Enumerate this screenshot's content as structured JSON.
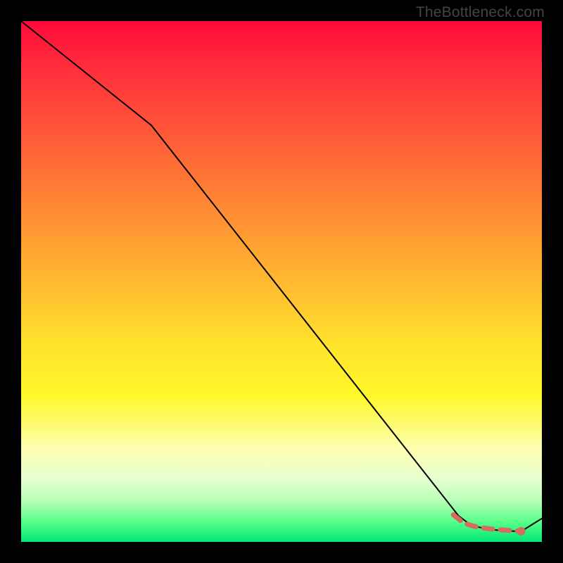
{
  "brand": "TheBottleneck.com",
  "colors": {
    "line": "#000000",
    "dashed": "#d86a60",
    "marker": "#d86a60",
    "background_black": "#000000"
  },
  "chart_data": {
    "type": "line",
    "title": "",
    "xlabel": "",
    "ylabel": "",
    "xlim": [
      0,
      100
    ],
    "ylim": [
      0,
      100
    ],
    "grid": false,
    "series": [
      {
        "name": "black-curve",
        "style": "solid",
        "color": "#000000",
        "x": [
          0,
          25,
          84,
          86,
          88,
          90,
          92,
          94,
          96,
          100
        ],
        "y": [
          100,
          80,
          5,
          3.5,
          2.8,
          2.4,
          2.2,
          2.1,
          2.0,
          4.5
        ]
      },
      {
        "name": "secondary-dashed",
        "style": "dashed",
        "color": "#d86a60",
        "x": [
          83,
          85,
          87,
          88.5,
          90,
          91.5,
          93,
          94.5,
          96
        ],
        "y": [
          5.2,
          3.6,
          3.0,
          2.7,
          2.5,
          2.35,
          2.25,
          2.15,
          2.05
        ]
      }
    ],
    "markers": [
      {
        "name": "end-point",
        "x": 96,
        "y": 2.05,
        "color": "#d86a60"
      }
    ]
  }
}
